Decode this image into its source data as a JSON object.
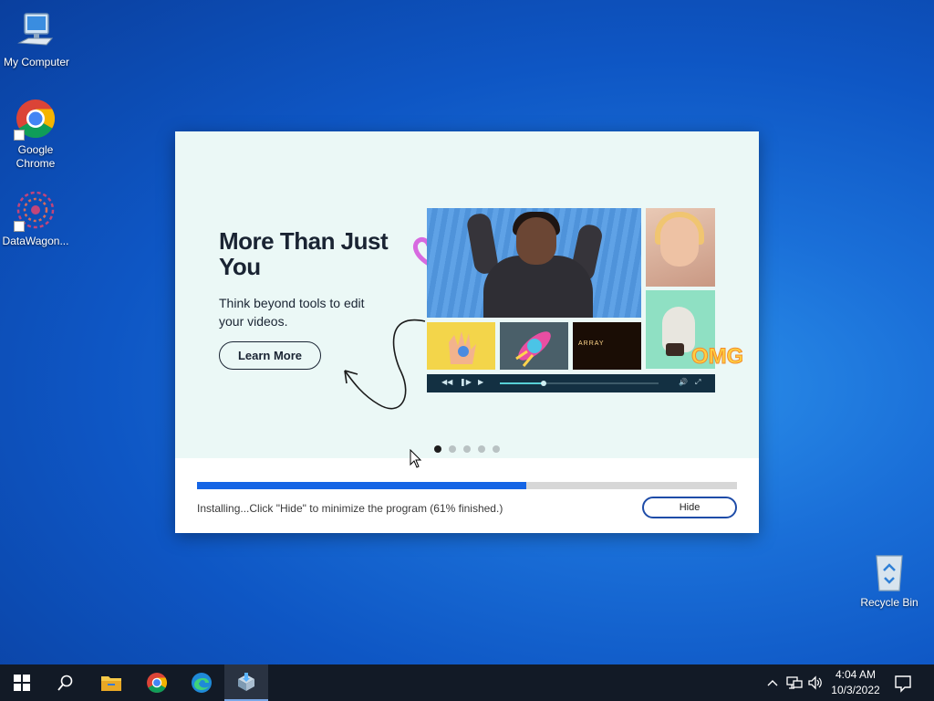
{
  "desktop": {
    "icons": [
      {
        "label": "My Computer"
      },
      {
        "label": "Google Chrome"
      },
      {
        "label": "DataWagon..."
      },
      {
        "label": "Recycle Bin"
      }
    ]
  },
  "installer": {
    "slide": {
      "headline": "More Than Just You",
      "subhead": "Think beyond tools to edit your videos.",
      "learn_more_label": "Learn More",
      "art_text": "ARRAY",
      "carousel_total": 5,
      "carousel_active": 1
    },
    "progress_percent": 61,
    "status_text": "Installing...Click \"Hide\" to minimize the program (61% finished.)",
    "hide_label": "Hide"
  },
  "taskbar": {
    "apps": [
      {
        "icon": "start-icon"
      },
      {
        "icon": "search-icon"
      },
      {
        "icon": "file-explorer-icon"
      },
      {
        "icon": "chrome-icon"
      },
      {
        "icon": "edge-icon"
      },
      {
        "icon": "installer-app-icon",
        "active": true
      }
    ],
    "clock": {
      "time": "4:04 AM",
      "date": "10/3/2022"
    }
  },
  "colors": {
    "accent": "#1565e5",
    "slide_background": "#ebf8f6",
    "taskbar": "#121a26"
  }
}
